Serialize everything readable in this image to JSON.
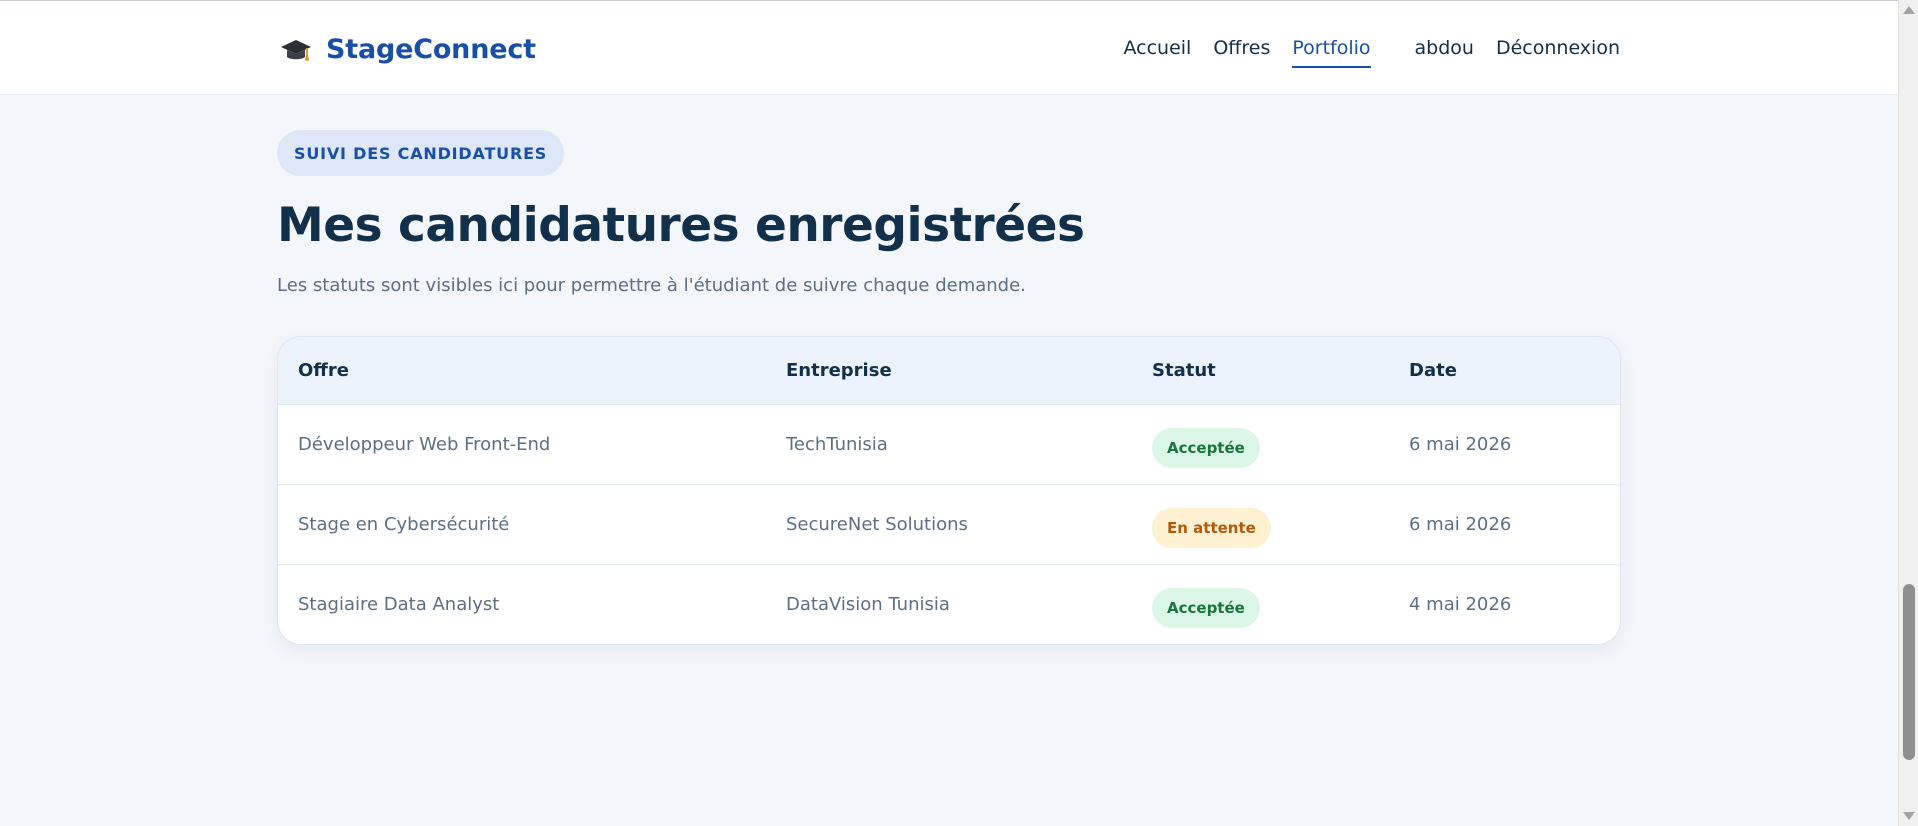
{
  "header": {
    "brand": "StageConnect",
    "brand_icon": "graduation-cap-icon",
    "nav": [
      {
        "label": "Accueil",
        "active": false
      },
      {
        "label": "Offres",
        "active": false
      },
      {
        "label": "Portfolio",
        "active": true
      }
    ],
    "user": "abdou",
    "logout": "Déconnexion",
    "accent_color": "#1a4fa8"
  },
  "page": {
    "eyebrow": "SUIVI DES CANDIDATURES",
    "title": "Mes candidatures enregistrées",
    "subtitle": "Les statuts sont visibles ici pour permettre à l'étudiant de suivre chaque demande."
  },
  "table": {
    "columns": [
      "Offre",
      "Entreprise",
      "Statut",
      "Date"
    ],
    "rows": [
      {
        "offre": "Développeur Web Front-End",
        "entreprise": "TechTunisia",
        "statut": "Acceptée",
        "statut_type": "accepted",
        "date": "6 mai 2026"
      },
      {
        "offre": "Stage en Cybersécurité",
        "entreprise": "SecureNet Solutions",
        "statut": "En attente",
        "statut_type": "pending",
        "date": "6 mai 2026"
      },
      {
        "offre": "Stagiaire Data Analyst",
        "entreprise": "DataVision Tunisia",
        "statut": "Acceptée",
        "statut_type": "accepted",
        "date": "4 mai 2026"
      }
    ],
    "status_colors": {
      "accepted": "#16763c",
      "pending": "#b45a0a"
    }
  }
}
